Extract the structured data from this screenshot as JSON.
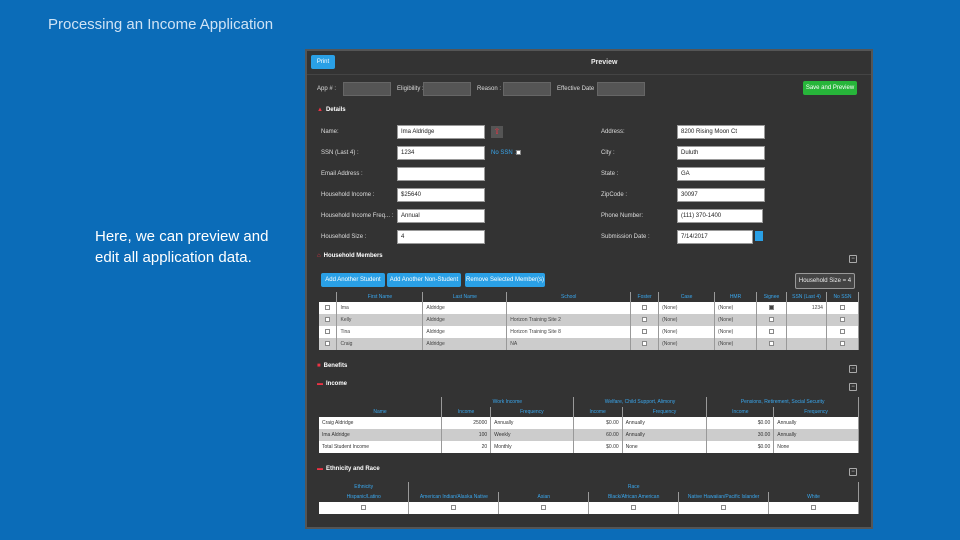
{
  "slide": {
    "title": "Processing an Income Application",
    "caption": "Here, we can preview and edit all application data."
  },
  "app": {
    "print_label": "Print",
    "preview_title": "Preview",
    "save_preview_label": "Save and Preview",
    "top_fields": {
      "app_label": "App # :",
      "eligibility_label": "Eligibility :",
      "reason_label": "Reason :",
      "effective_date_label": "Effective Date"
    },
    "details": {
      "title": "Details",
      "name_label": "Name:",
      "name_value": "Ima Aldridge",
      "address_label": "Address:",
      "address_value": "8200 Rising Moon Ct",
      "ssn_label": "SSN (Last 4) :",
      "ssn_value": "1234",
      "no_ssn_label": "No SSN :",
      "city_label": "City :",
      "city_value": "Duluth",
      "email_label": "Email Address :",
      "email_value": "",
      "state_label": "State :",
      "state_value": "GA",
      "household_income_label": "Household Income :",
      "household_income_value": "$25640",
      "zip_label": "ZipCode :",
      "zip_value": "30097",
      "frequency_label": "Household Income Freq... :",
      "frequency_value": "Annual",
      "phone_label": "Phone Number:",
      "phone_value": "(111) 370-1400",
      "size_label": "Household Size :",
      "size_value": "4",
      "submission_label": "Submission Date :",
      "submission_value": "7/14/2017"
    },
    "members": {
      "title": "Household Members",
      "add_student_label": "Add Another Student",
      "add_non_student_label": "Add Another Non-Student",
      "remove_label": "Remove Selected Member(s)",
      "household_size_label": "Household Size = 4",
      "columns": [
        "",
        "First Name",
        "Last Name",
        "School",
        "Foster",
        "Case",
        "HMR",
        "Signee",
        "SSN (Last 4)",
        "No SSN"
      ],
      "rows": [
        {
          "first": "Ima",
          "last": "Aldridge",
          "school": "",
          "case": "(None)",
          "hmr": "(None)",
          "signee": true,
          "ssn": "1234"
        },
        {
          "first": "Kelly",
          "last": "Aldridge",
          "school": "Horizon Training Site 2",
          "case": "(None)",
          "hmr": "(None)",
          "signee": false,
          "ssn": ""
        },
        {
          "first": "Tina",
          "last": "Aldridge",
          "school": "Horizon Training Site 8",
          "case": "(None)",
          "hmr": "(None)",
          "signee": false,
          "ssn": ""
        },
        {
          "first": "Craig",
          "last": "Aldridge",
          "school": "NA",
          "case": "(None)",
          "hmr": "(None)",
          "signee": false,
          "ssn": ""
        }
      ]
    },
    "benefits": {
      "title": "Benefits"
    },
    "income": {
      "title": "Income",
      "groups": [
        "Work Income",
        "Welfare, Child Support, Alimony",
        "Pensions, Retirement, Social Security"
      ],
      "columns": [
        "Name",
        "Income",
        "Frequency",
        "Income",
        "Frequency",
        "Income",
        "Frequency"
      ],
      "rows": [
        {
          "name": "Craig Aldridge",
          "i1": "25000",
          "f1": "Annually",
          "i2": "$0.00",
          "f2": "Annually",
          "i3": "$0.00",
          "f3": "Annually"
        },
        {
          "name": "Ima Aldridge",
          "i1": "100",
          "f1": "Weekly",
          "i2": "60.00",
          "f2": "Annually",
          "i3": "30.00",
          "f3": "Annually"
        },
        {
          "name": "Total Student Income",
          "i1": "20",
          "f1": "Monthly",
          "i2": "$0.00",
          "f2": "None",
          "i3": "$0.00",
          "f3": "None"
        }
      ]
    },
    "ethnicity": {
      "title": "Ethnicity and Race",
      "ethnicity_label": "Ethnicity",
      "race_label": "Race",
      "columns": [
        "Hispanic/Latino",
        "American Indian/Alaska Native",
        "Asian",
        "Black/African American",
        "Native Hawaiian/Pacific Islander",
        "White"
      ]
    }
  }
}
